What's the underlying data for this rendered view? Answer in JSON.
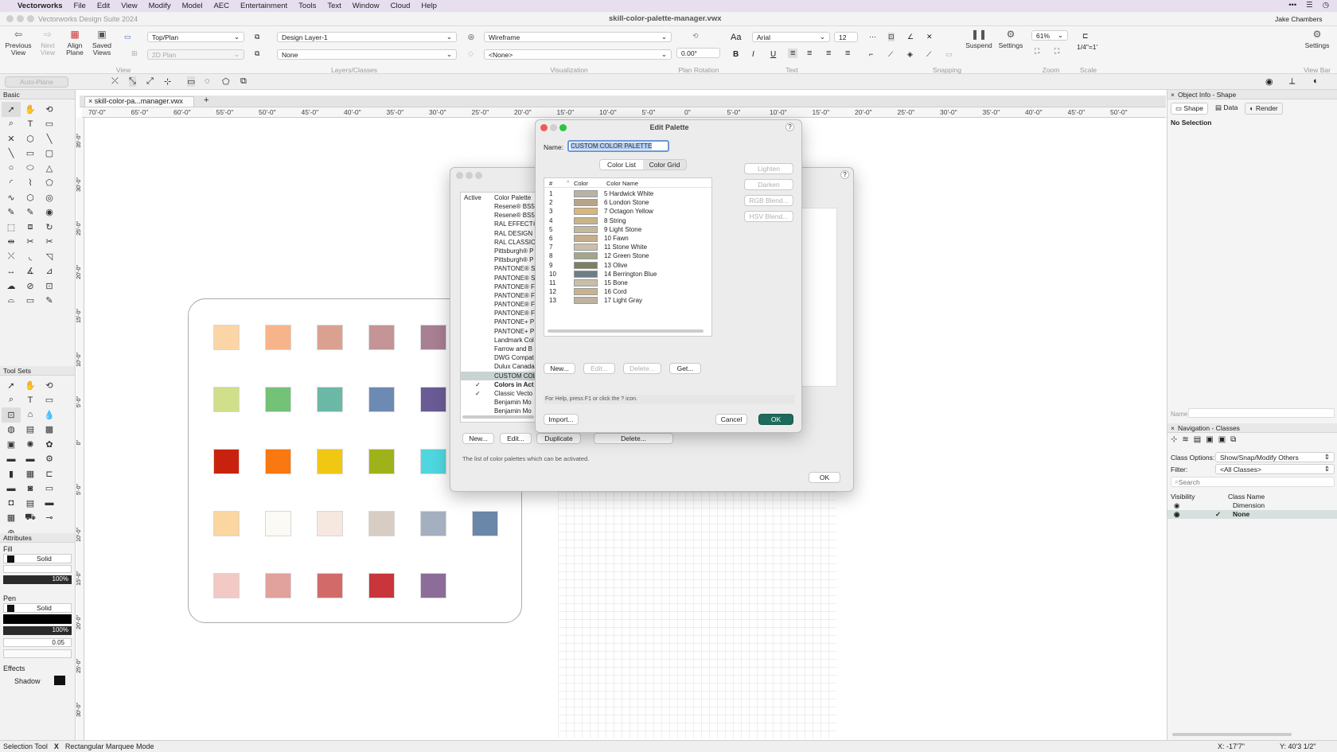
{
  "menu": {
    "apple": "",
    "app": "Vectorworks",
    "items": [
      "File",
      "Edit",
      "View",
      "Modify",
      "Model",
      "AEC",
      "Entertainment",
      "Tools",
      "Text",
      "Window",
      "Cloud",
      "Help"
    ]
  },
  "window": {
    "app_title": "Vectorworks Design Suite 2024",
    "doc_title": "skill-color-palette-manager.vwx",
    "user": "Jake Chambers"
  },
  "toolbar": {
    "previous_view": "Previous View",
    "next_view": "Next View",
    "align_plane": "Align Plane",
    "saved_views": "Saved Views",
    "view_group": "View",
    "view_mode": "Top/Plan",
    "plane": "2D Plan",
    "layer": "Design Layer-1",
    "class": "None",
    "layers_group": "Layers/Classes",
    "render_mode": "Wireframe",
    "render_sub": "<None>",
    "viz_group": "Visualization",
    "rotation": "0.00°",
    "rotation_group": "Plan Rotation",
    "font": "Arial",
    "size": "12",
    "text_group": "Text",
    "snapping_group": "Snapping",
    "suspend": "Suspend",
    "settings": "Settings",
    "zoom": "61%",
    "zoom_group": "Zoom",
    "scale": "1/4\"=1'",
    "scale_group": "Scale",
    "view_bar_settings": "Settings",
    "view_bar": "View Bar"
  },
  "row2": {
    "auto_plane": "Auto-Plane"
  },
  "basic": {
    "title": "Basic"
  },
  "toolsets": {
    "title": "Tool Sets"
  },
  "attributes": {
    "title": "Attributes",
    "fill": "Fill",
    "fill_style": "Solid",
    "fill_opacity": "100%",
    "pen": "Pen",
    "pen_style": "Solid",
    "pen_opacity": "100%",
    "line_weight": "0.05",
    "effects": "Effects",
    "shadow": "Shadow"
  },
  "doc_tab": "skill-color-pa...manager.vwx",
  "ruler_labels": [
    "70'-0\"",
    "65'-0\"",
    "60'-0\"",
    "55'-0\"",
    "50'-0\"",
    "45'-0\"",
    "40'-0\"",
    "35'-0\"",
    "30'-0\"",
    "25'-0\"",
    "20'-0\"",
    "15'-0\"",
    "10'-0\"",
    "5'-0\"",
    "0\"",
    "5'-0\"",
    "10'-0\"",
    "15'-0\"",
    "20'-0\"",
    "25'-0\"",
    "30'-0\"",
    "35'-0\"",
    "40'-0\"",
    "45'-0\"",
    "50'-0\""
  ],
  "vruler_labels": [
    "35'-0\"",
    "30'-0\"",
    "25'-0\"",
    "20'-0\"",
    "15'-0\"",
    "10'-0\"",
    "5'-0\"",
    "0\"",
    "5'-0\"",
    "10'-0\"",
    "15'-0\"",
    "20'-0\"",
    "25'-0\"",
    "30'-0\""
  ],
  "swatches": [
    [
      "#fbd5a6",
      "#f7b48a",
      "#dba190",
      "#c49496",
      "#a87f93"
    ],
    [
      "#cfdf8a",
      "#74c277",
      "#6cb8a6",
      "#6d8ab5",
      "#6a5b96"
    ],
    [
      "#c8220e",
      "#f9780f",
      "#f0c814",
      "#a0b21a",
      "#4fd7df"
    ],
    [
      "#fbd6a0",
      "#fbfaf5",
      "#f6e7df",
      "#d8cdc3",
      "#a4afbf",
      "#6a86a8"
    ],
    [
      "#f2c9c4",
      "#e1a19c",
      "#d36a6a",
      "#c8353a",
      "#8c6c98"
    ]
  ],
  "palette_manager": {
    "col_active": "Active",
    "col_palette": "Color Palette",
    "items": [
      "Resene® BS5",
      "Resene® BS5",
      "RAL EFFECT®",
      "RAL DESIGN",
      "RAL CLASSIC",
      "Pittsburgh® P",
      "Pittsburgh® P",
      "PANTONE® S",
      "PANTONE® S",
      "PANTONE® F",
      "PANTONE® F",
      "PANTONE® F",
      "PANTONE® F",
      "PANTONE+ P",
      "PANTONE+ P",
      "Landmark Col",
      "Farrow and B",
      "DWG Compat",
      "Dulux Canada",
      "CUSTOM COL",
      "Colors in Act",
      "Classic Vecto",
      "Benjamin Mo",
      "Benjamin Mo"
    ],
    "new": "New...",
    "edit": "Edit...",
    "duplicate": "Duplicate",
    "delete": "Delete...",
    "help": "The list of color palettes which can be activated.",
    "ok": "OK"
  },
  "edit_palette": {
    "title": "Edit Palette",
    "name_label": "Name:",
    "name_value": "CUSTOM COLOR PALETTE",
    "tab_list": "Color List",
    "tab_grid": "Color Grid",
    "col_num": "#",
    "col_color": "Color",
    "col_name": "Color Name",
    "rows": [
      {
        "n": "1",
        "name": "5 Hardwick White",
        "c": "#b9b3a6"
      },
      {
        "n": "2",
        "name": "6 London Stone",
        "c": "#b9a48a"
      },
      {
        "n": "3",
        "name": "7 Octagon Yellow",
        "c": "#d8b77a"
      },
      {
        "n": "4",
        "name": "8 String",
        "c": "#c7b48a"
      },
      {
        "n": "5",
        "name": "9 Light Stone",
        "c": "#c4b89c"
      },
      {
        "n": "6",
        "name": "10 Fawn",
        "c": "#c7ad8a"
      },
      {
        "n": "7",
        "name": "11 Stone White",
        "c": "#c9c0ac"
      },
      {
        "n": "8",
        "name": "12 Green Stone",
        "c": "#a3a68a"
      },
      {
        "n": "9",
        "name": "13 Olive",
        "c": "#7d7f62"
      },
      {
        "n": "10",
        "name": "14 Berrington Blue",
        "c": "#6f7d86"
      },
      {
        "n": "11",
        "name": "15 Bone",
        "c": "#c9bfa8"
      },
      {
        "n": "12",
        "name": "16 Cord",
        "c": "#c7b38e"
      },
      {
        "n": "13",
        "name": "17 Light Gray",
        "c": "#bdb3a0"
      }
    ],
    "lighten": "Lighten",
    "darken": "Darken",
    "rgb_blend": "RGB Blend...",
    "hsv_blend": "HSV Blend...",
    "new": "New...",
    "edit": "Edit...",
    "delete": "Delete...",
    "get": "Get...",
    "help": "For Help, press F1 or click the ? icon.",
    "import": "Import...",
    "cancel": "Cancel",
    "ok": "OK"
  },
  "object_info": {
    "title": "Object Info - Shape",
    "tab_shape": "Shape",
    "tab_data": "Data",
    "tab_render": "Render",
    "selection": "No Selection",
    "name_label": "Name:"
  },
  "navigation": {
    "title": "Navigation - Classes",
    "class_options_label": "Class Options:",
    "class_options": "Show/Snap/Modify Others",
    "filter_label": "Filter:",
    "filter": "<All Classes>",
    "search_placeholder": "Search",
    "col_visibility": "Visibility",
    "col_class": "Class Name",
    "rows": [
      "Dimension",
      "None"
    ]
  },
  "status": {
    "tool": "Selection Tool",
    "mode": "Rectangular Marquee Mode",
    "x": "X: -17'7\"",
    "y": "Y: 40'3 1/2\""
  }
}
